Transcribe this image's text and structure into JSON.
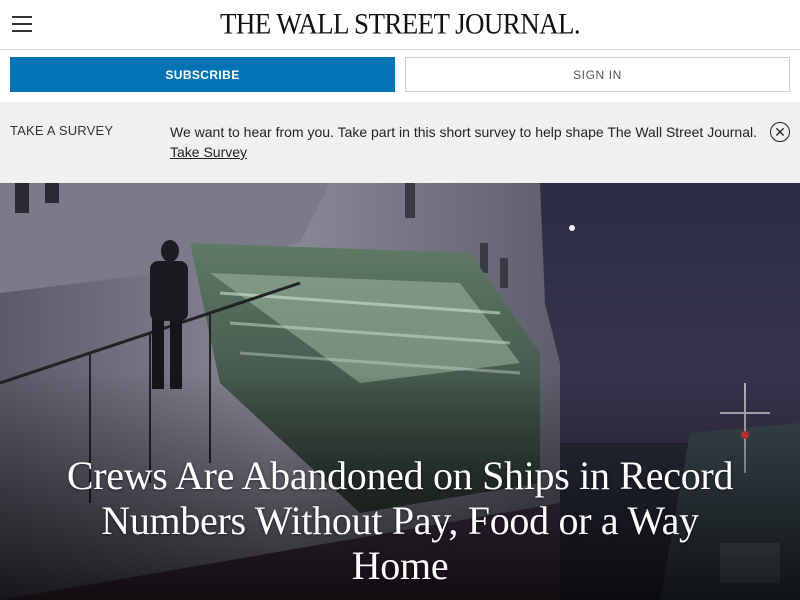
{
  "header": {
    "logo": "THE WALL STREET JOURNAL.",
    "menu_icon": "hamburger-menu-icon"
  },
  "actions": {
    "subscribe_label": "SUBSCRIBE",
    "signin_label": "SIGN IN"
  },
  "survey": {
    "label": "TAKE A SURVEY",
    "message": "We want to hear from you. Take part in this short survey to help shape The Wall Street Journal.",
    "link_label": "Take Survey",
    "close_icon": "close-circle-icon"
  },
  "article": {
    "headline": "Crews Are Abandoned on Ships in Record Numbers Without Pay, Food or a Way Home"
  },
  "colors": {
    "subscribe_bg": "#0274b6",
    "survey_bg": "#f0f0f0"
  }
}
